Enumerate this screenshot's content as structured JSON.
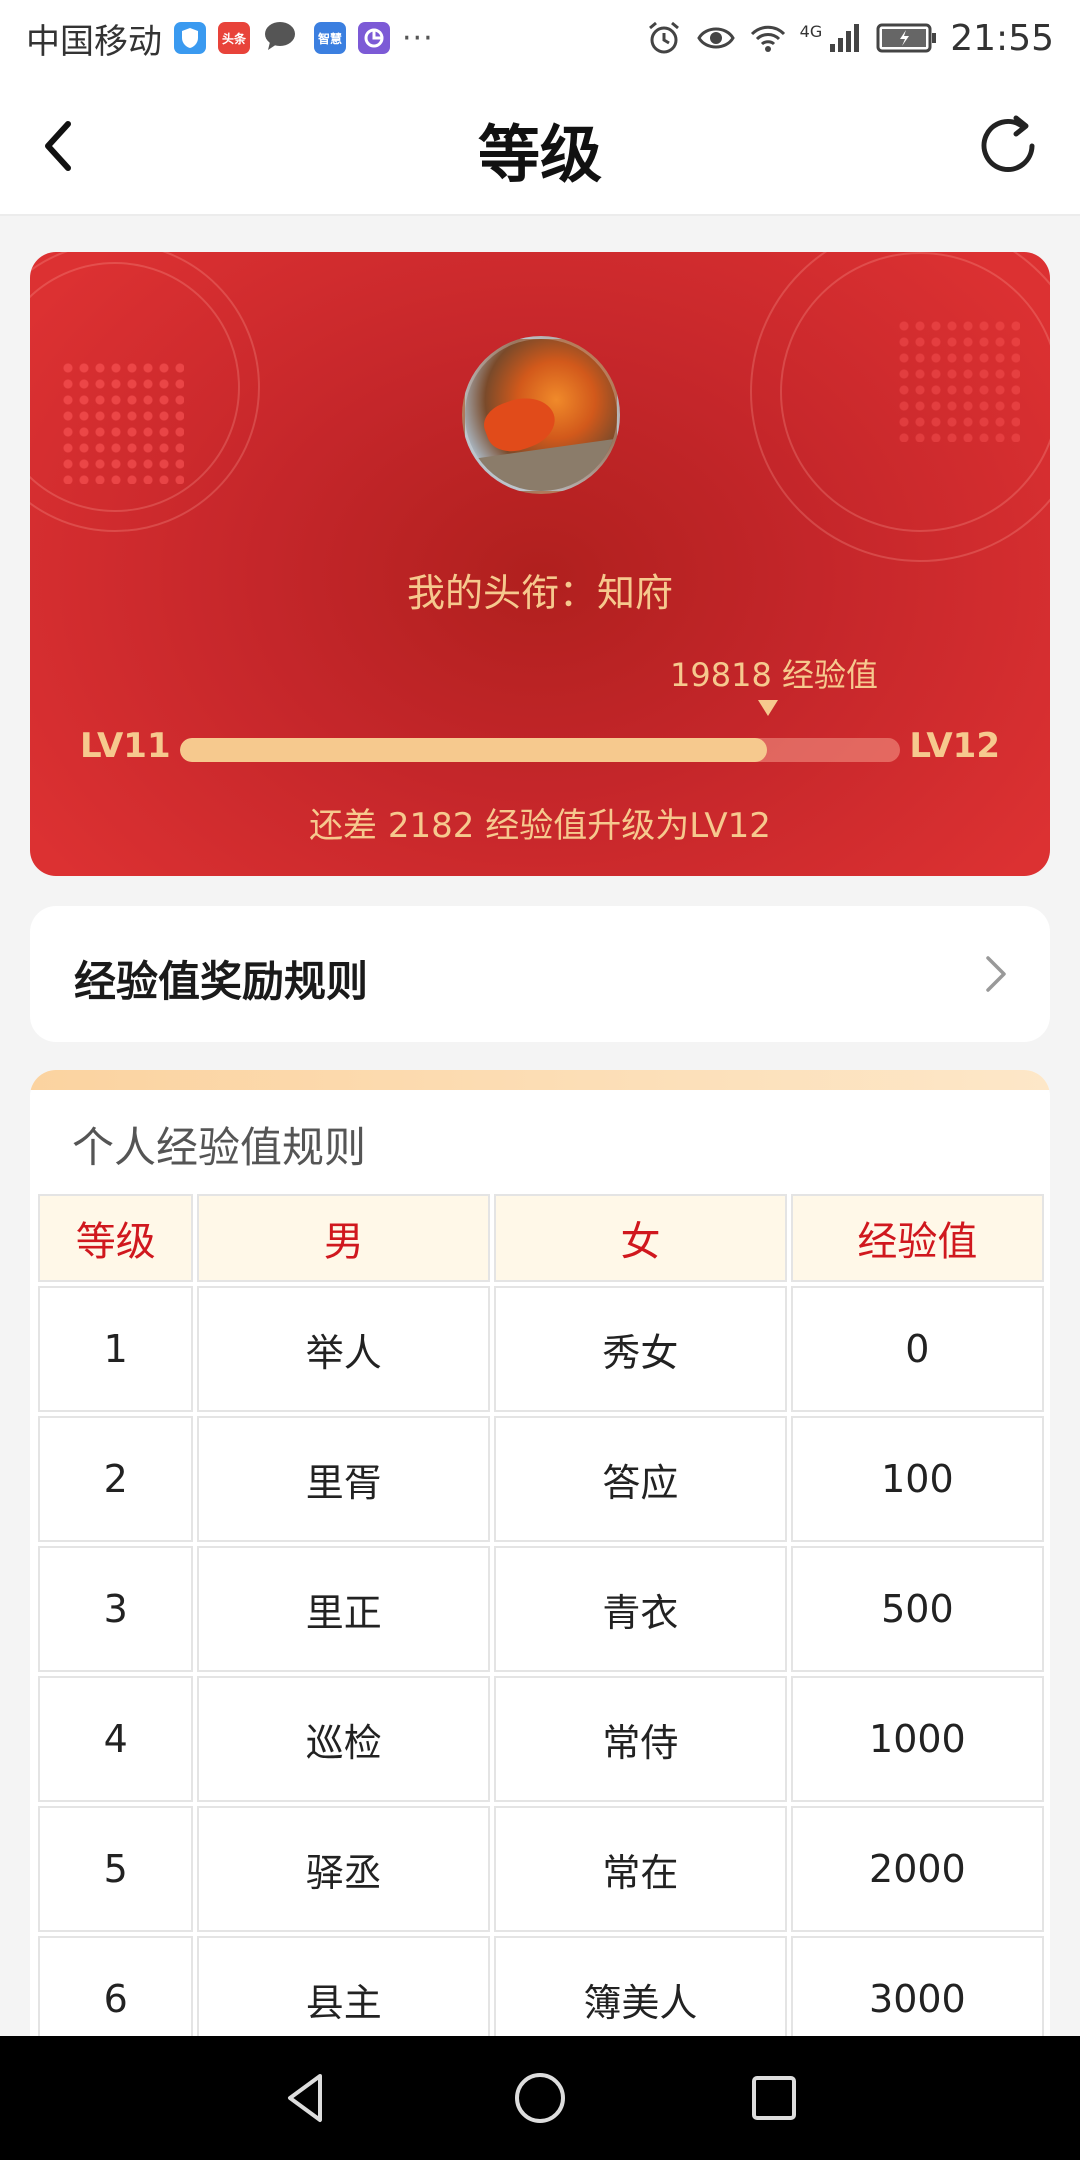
{
  "status_bar": {
    "carrier": "中国移动",
    "app_icons": [
      {
        "name": "shield-app-icon",
        "color": "#3a9af0",
        "text": ""
      },
      {
        "name": "toutiao-app-icon",
        "color": "#e8433a",
        "text": "头条"
      },
      {
        "name": "message-app-icon",
        "color": "#555555",
        "text": ""
      },
      {
        "name": "zhihui-app-icon",
        "color": "#3b7fe0",
        "text": "智慧"
      },
      {
        "name": "chart-app-icon",
        "color": "#7c5ad6",
        "text": ""
      }
    ],
    "more": "···",
    "network": "4G",
    "time": "21:55"
  },
  "nav": {
    "title": "等级"
  },
  "level_card": {
    "title_text": "我的头衔：知府",
    "current_exp_text": "19818 经验值",
    "current_level": "LV11",
    "next_level": "LV12",
    "progress_fraction": 0.815,
    "hint": "还差 2182 经验值升级为LV12"
  },
  "rules_link": {
    "label": "经验值奖励规则"
  },
  "table": {
    "heading": "个人经验值规则",
    "columns": [
      "等级",
      "男",
      "女",
      "经验值"
    ],
    "rows": [
      [
        "1",
        "举人",
        "秀女",
        "0"
      ],
      [
        "2",
        "里胥",
        "答应",
        "100"
      ],
      [
        "3",
        "里正",
        "青衣",
        "500"
      ],
      [
        "4",
        "巡检",
        "常侍",
        "1000"
      ],
      [
        "5",
        "驿丞",
        "常在",
        "2000"
      ],
      [
        "6",
        "县主",
        "簿美人",
        "3000"
      ]
    ]
  },
  "colors": {
    "card_red": "#c4262a",
    "gold_text": "#f6c98e",
    "header_red": "#d0181e",
    "header_bg": "#fff8e8"
  }
}
